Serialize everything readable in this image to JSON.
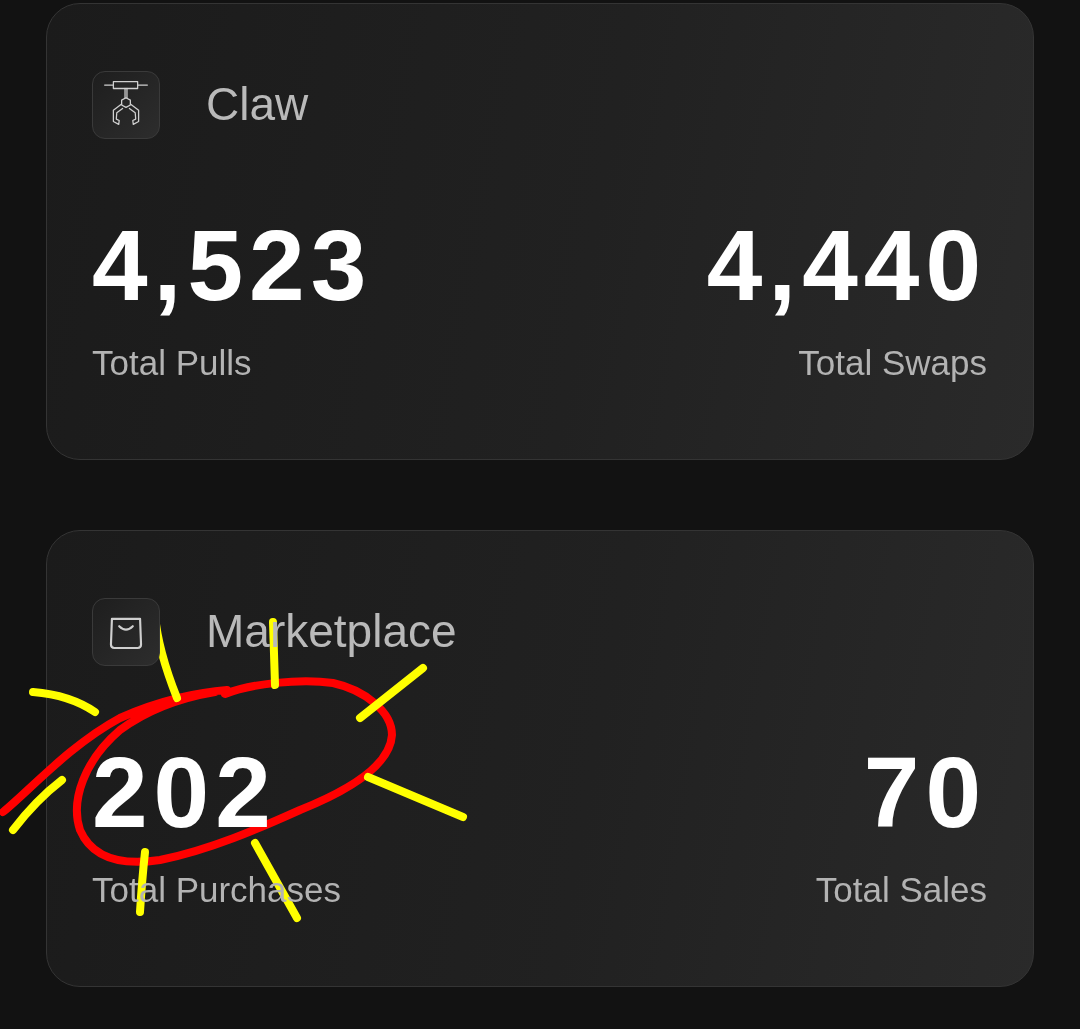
{
  "cards": [
    {
      "kind": "claw",
      "title": "Claw",
      "stats": [
        {
          "value": "4,523",
          "label": "Total Pulls"
        },
        {
          "value": "4,440",
          "label": "Total Swaps"
        }
      ]
    },
    {
      "kind": "marketplace",
      "title": "Marketplace",
      "stats": [
        {
          "value": "202",
          "label": "Total Purchases"
        },
        {
          "value": "70",
          "label": "Total Sales"
        }
      ]
    }
  ]
}
